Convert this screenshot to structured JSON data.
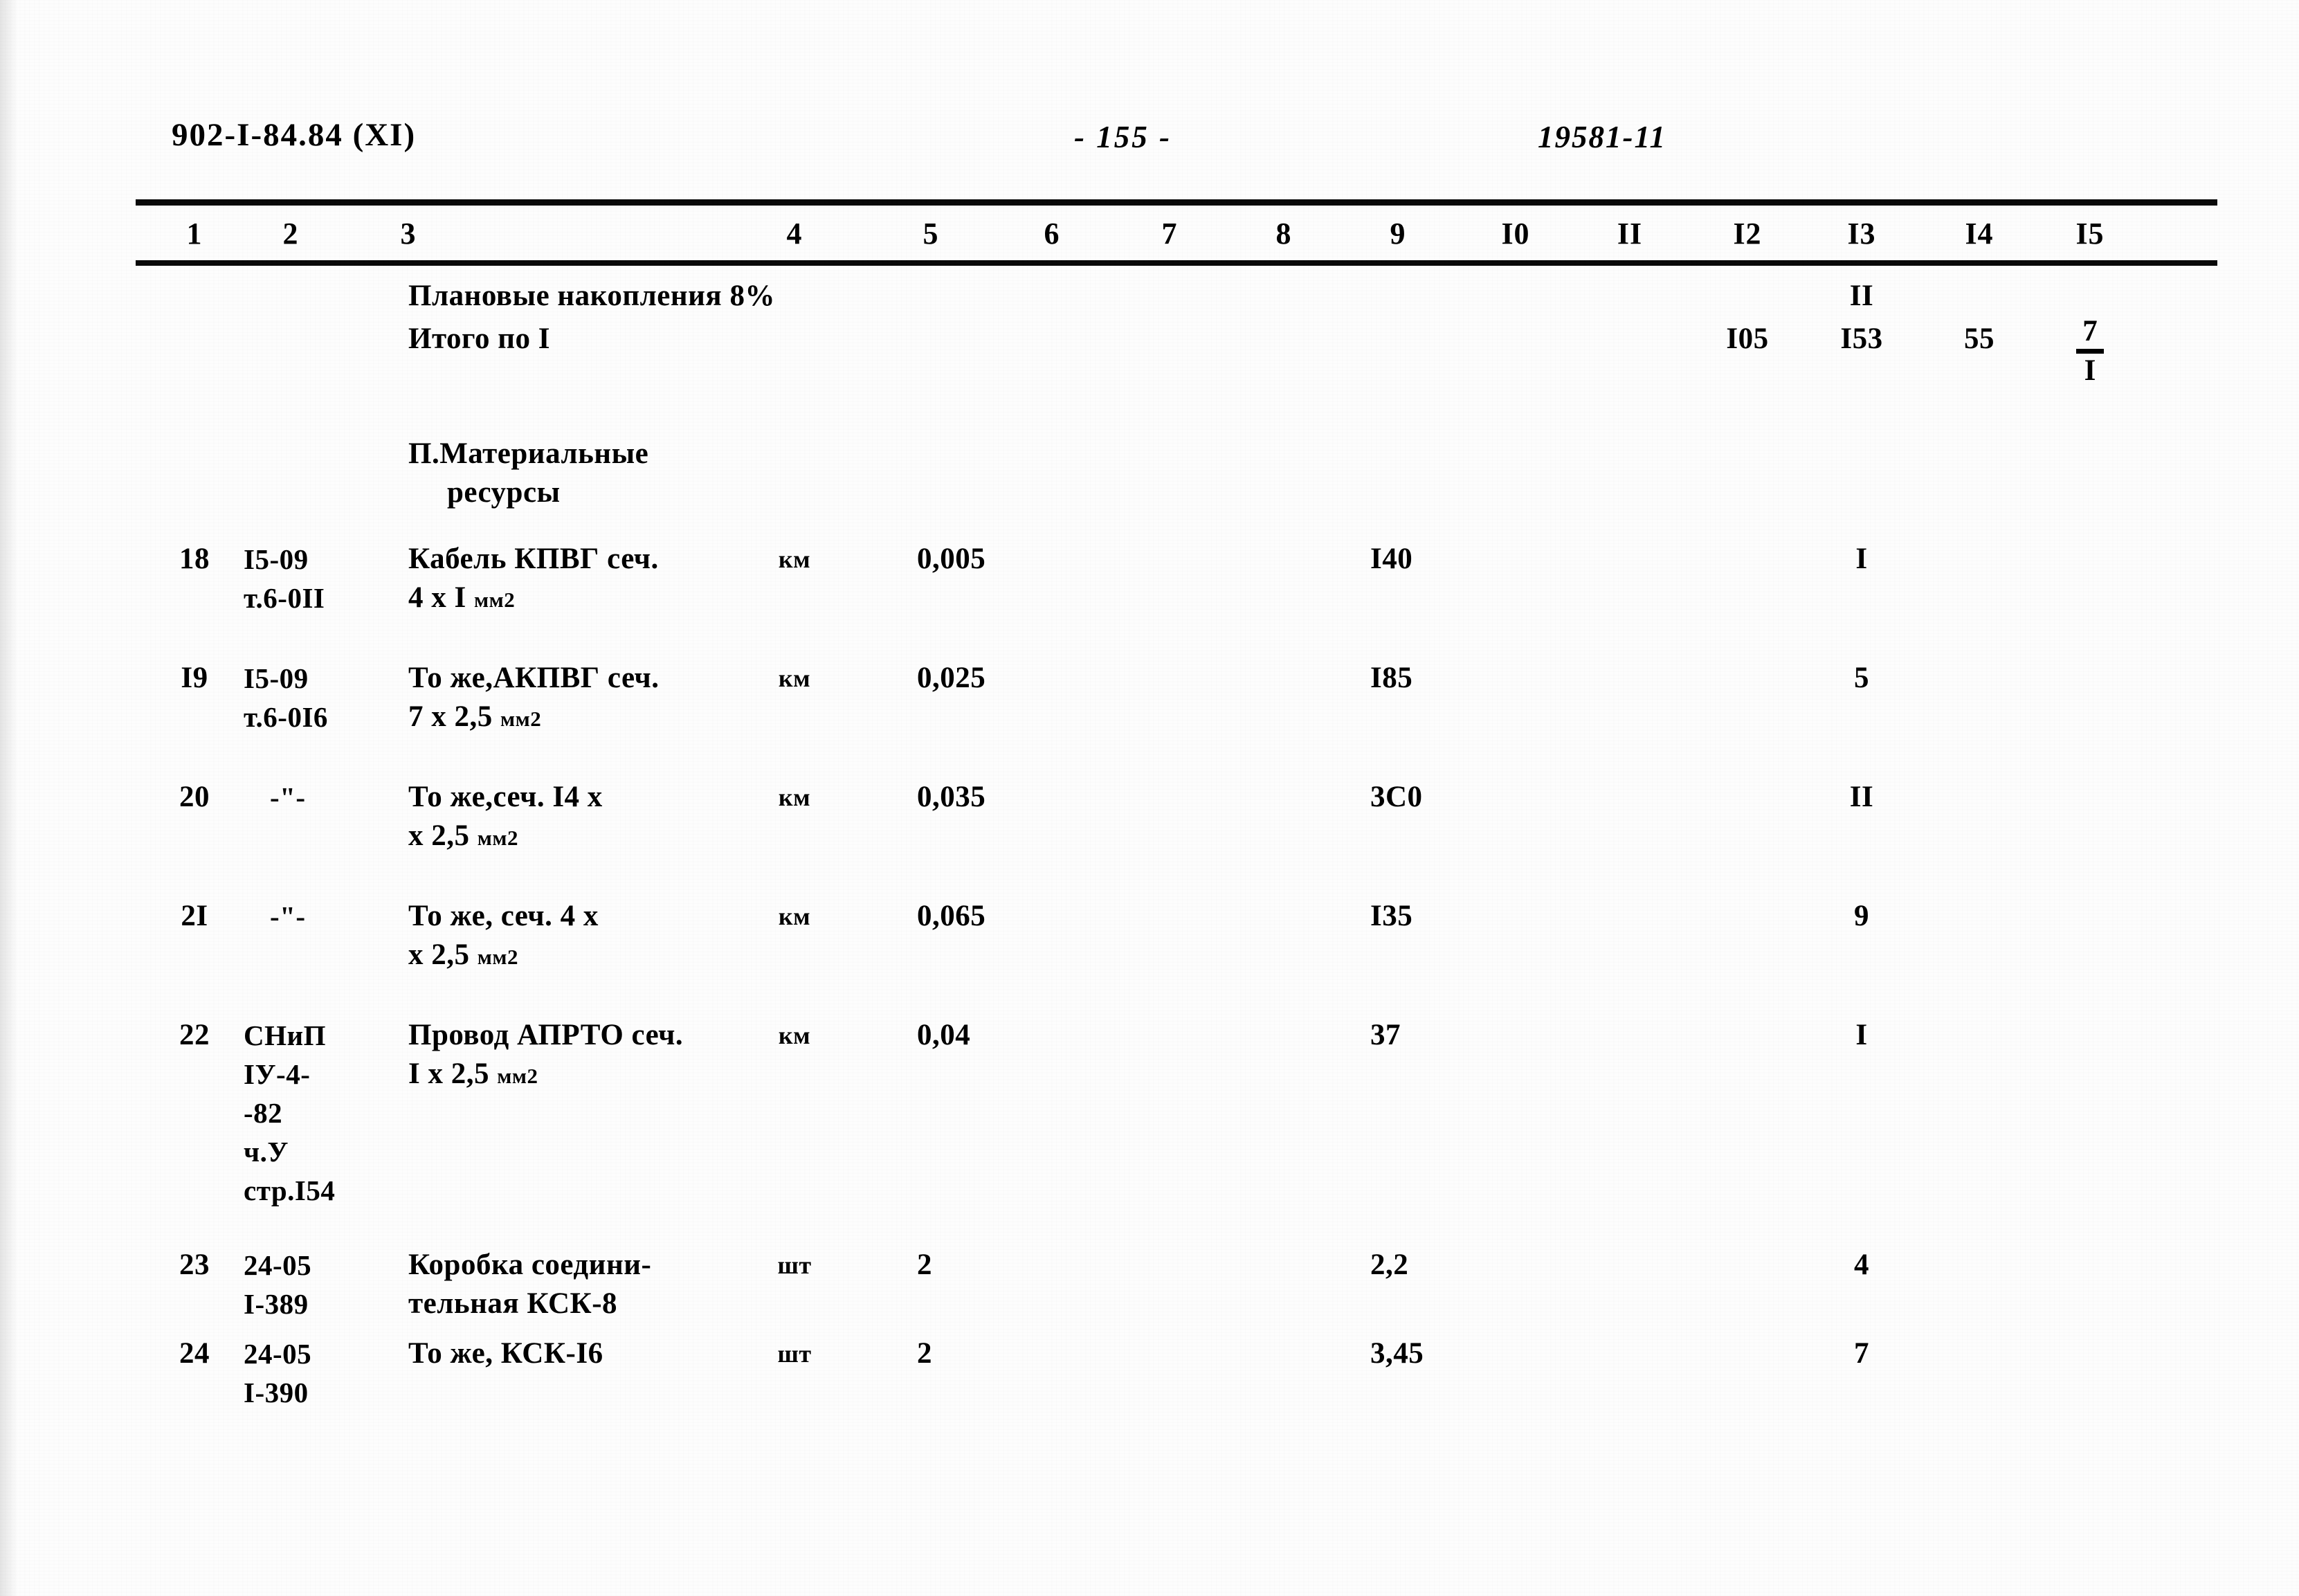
{
  "header": {
    "document_code": "902-I-84.84  (XI)",
    "page_number": "- 155 -",
    "right_code": "19581-11"
  },
  "table": {
    "column_numbers": [
      "1",
      "2",
      "3",
      "4",
      "5",
      "6",
      "7",
      "8",
      "9",
      "I0",
      "II",
      "I2",
      "I3",
      "I4",
      "I5"
    ],
    "summary_rows": [
      {
        "name": "planned-savings",
        "description": "Плановые накопления 8%",
        "col12": "",
        "col13": "II",
        "col14": "",
        "col15": ""
      },
      {
        "name": "total-section-1",
        "description": "Итого по I",
        "col12": "I05",
        "col13": "I53",
        "col14": "55",
        "col15_numerator": "7",
        "col15_denominator": "I"
      }
    ],
    "section_heading": {
      "line1": "П.Материальные",
      "line2": "ресурсы"
    },
    "rows": [
      {
        "no": "18",
        "code_line1": "I5-09",
        "code_line2": "т.6-0II",
        "desc_line1": "Кабель КПВГ сеч.",
        "desc_line2": "4 х I",
        "desc_line2_unit": "мм2",
        "unit": "км",
        "qty": "0,005",
        "col9": "I40",
        "col13": "I"
      },
      {
        "no": "I9",
        "code_line1": "I5-09",
        "code_line2": "т.6-0I6",
        "desc_line1": "То же,АКПВГ сеч.",
        "desc_line2": "7 х 2,5",
        "desc_line2_unit": "мм2",
        "unit": "км",
        "qty": "0,025",
        "col9": "I85",
        "col13": "5"
      },
      {
        "no": "20",
        "code_line1": "-\"-",
        "code_line2": "",
        "desc_line1": "То же,сеч. I4 х",
        "desc_line2": "х 2,5",
        "desc_line2_unit": "мм2",
        "unit": "км",
        "qty": "0,035",
        "col9": "3С0",
        "col13": "II"
      },
      {
        "no": "2I",
        "code_line1": "-\"-",
        "code_line2": "",
        "desc_line1": "То же, сеч. 4 х",
        "desc_line2": "х 2,5",
        "desc_line2_unit": "мм2",
        "unit": "км",
        "qty": "0,065",
        "col9": "I35",
        "col13": "9"
      },
      {
        "no": "22",
        "code_line1": "СНиП",
        "code_line2": "IУ-4-",
        "code_line3": "-82",
        "code_line4": "ч.У",
        "code_line5": "стр.I54",
        "desc_line1": "Провод АПРТО сеч.",
        "desc_line2": "I х 2,5",
        "desc_line2_unit": "мм2",
        "unit": "км",
        "qty": "0,04",
        "col9": "37",
        "col13": "I"
      },
      {
        "no": "23",
        "code_line1": "24-05",
        "code_line2": "I-389",
        "desc_line1": "Коробка соедини-",
        "desc_line2": "тельная КСК-8",
        "desc_line2_unit": "",
        "unit": "шт",
        "qty": "2",
        "col9": "2,2",
        "col13": "4"
      },
      {
        "no": "24",
        "code_line1": "24-05",
        "code_line2": "I-390",
        "desc_line1": "То же, КСК-I6",
        "desc_line2": "",
        "desc_line2_unit": "",
        "unit": "шт",
        "qty": "2",
        "col9": "3,45",
        "col13": "7"
      }
    ]
  }
}
